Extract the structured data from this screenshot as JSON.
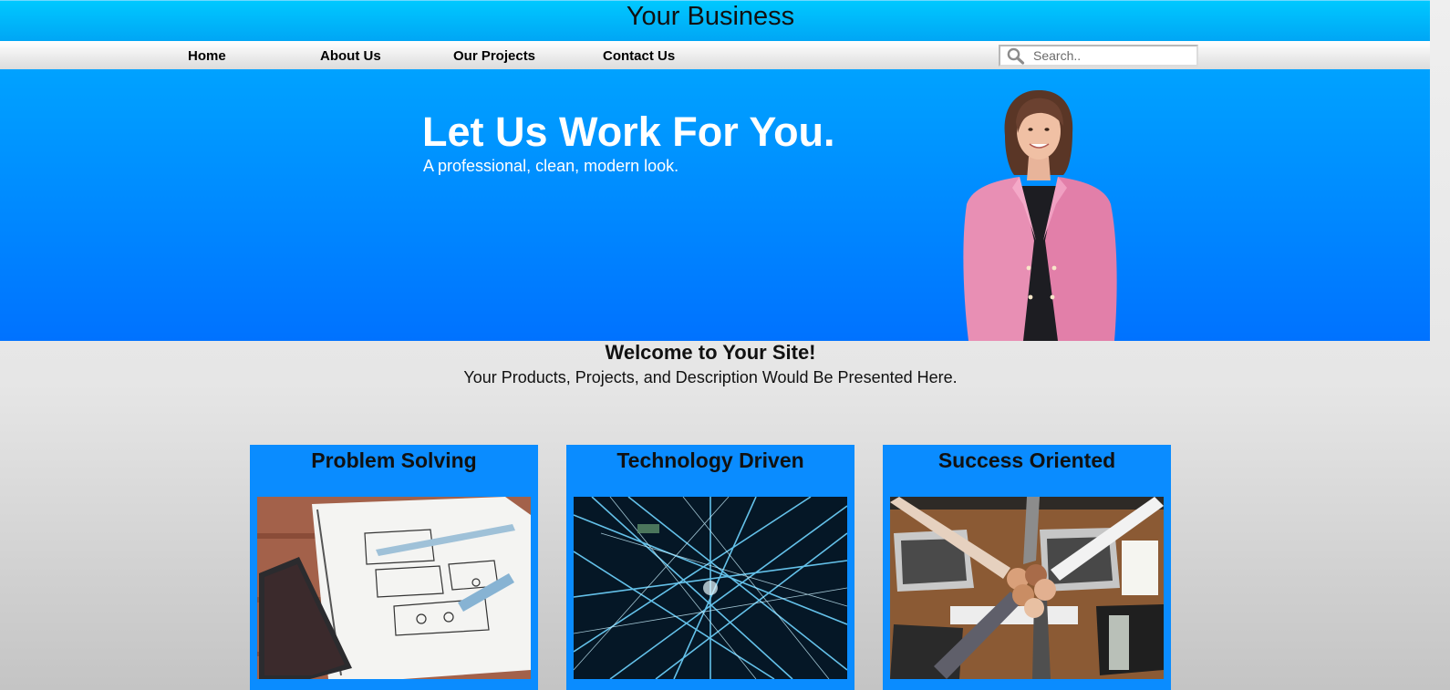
{
  "header": {
    "brand": "Your Business"
  },
  "nav": {
    "items": [
      {
        "label": "Home"
      },
      {
        "label": "About Us"
      },
      {
        "label": "Our Projects"
      },
      {
        "label": "Contact Us"
      }
    ],
    "search": {
      "placeholder": "Search..",
      "value": "",
      "icon": "search-icon"
    }
  },
  "hero": {
    "title": "Let Us Work For You.",
    "subtitle": "A professional, clean, modern look.",
    "photo": "businesswoman-pink-blazer"
  },
  "welcome": {
    "title": "Welcome to Your Site!",
    "subtitle": "Your Products, Projects, and Description Would Be Presented Here."
  },
  "cards": [
    {
      "title": "Problem Solving",
      "image": "notebook-wireframe-sketch-photo"
    },
    {
      "title": "Technology Driven",
      "image": "network-light-lines-photo"
    },
    {
      "title": "Success Oriented",
      "image": "team-fist-bump-photo"
    }
  ],
  "colors": {
    "header_top": "#00c8ff",
    "hero_top": "#00a2ff",
    "hero_bottom": "#0072ff",
    "card_bg": "#0a8cff"
  }
}
